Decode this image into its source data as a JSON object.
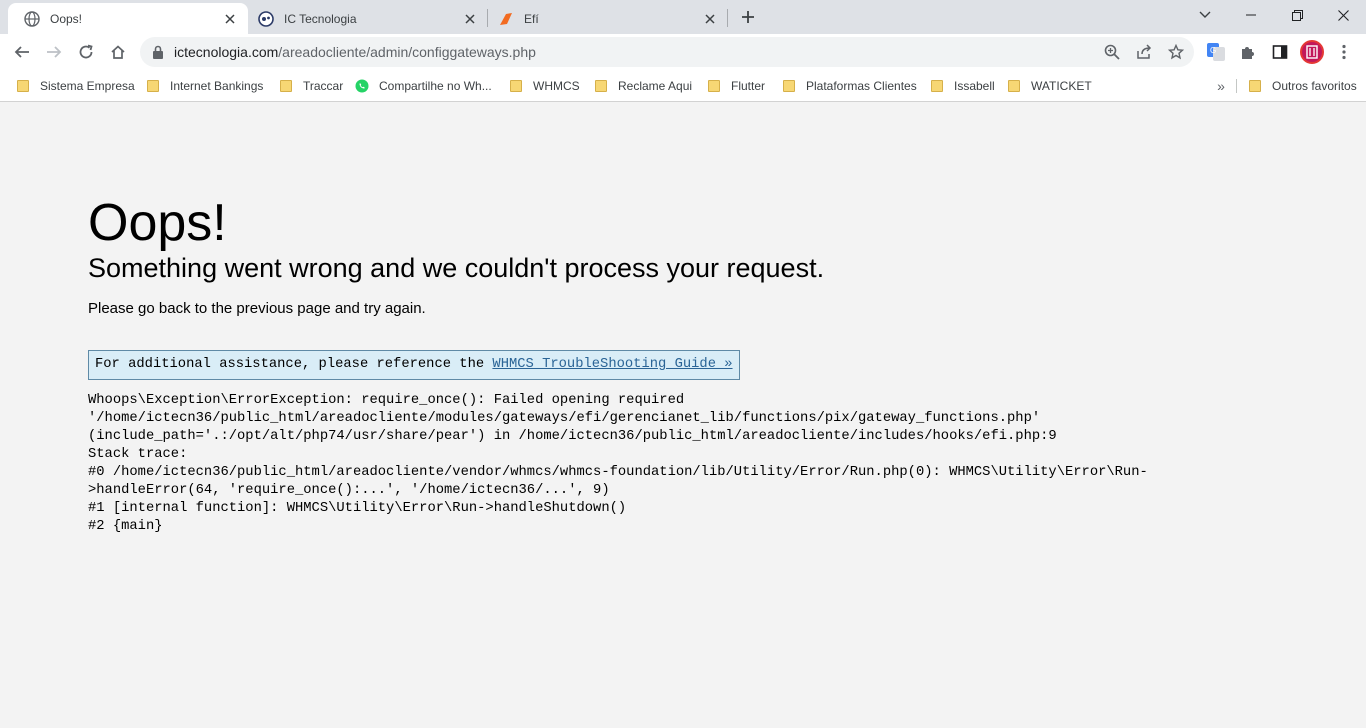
{
  "browser": {
    "tabs": [
      {
        "title": "Oops!",
        "icon": "globe-icon",
        "active": true
      },
      {
        "title": "IC Tecnologia",
        "icon": "ic-logo-icon",
        "active": false
      },
      {
        "title": "Efí",
        "icon": "efi-logo-icon",
        "active": false
      }
    ],
    "address_bar": {
      "domain": "ictecnologia.com",
      "path": "/areadocliente/admin/configgateways.php"
    },
    "bookmarks": [
      {
        "label": "Sistema Empresa",
        "icon": "folder-icon"
      },
      {
        "label": "Internet Bankings",
        "icon": "folder-icon"
      },
      {
        "label": "Traccar",
        "icon": "folder-icon"
      },
      {
        "label": "Compartilhe no Wh...",
        "icon": "whatsapp-icon"
      },
      {
        "label": "WHMCS",
        "icon": "folder-icon"
      },
      {
        "label": "Reclame Aqui",
        "icon": "folder-icon"
      },
      {
        "label": "Flutter",
        "icon": "folder-icon"
      },
      {
        "label": "Plataformas Clientes",
        "icon": "folder-icon"
      },
      {
        "label": "Issabell",
        "icon": "folder-icon"
      },
      {
        "label": "WATICKET",
        "icon": "folder-icon"
      }
    ],
    "more_bookmarks": "»",
    "other_bookmarks": "Outros favoritos",
    "colors": {
      "tabstrip": "#dee1e6",
      "toolbar": "#ffffff",
      "omnibox": "#f1f3f4",
      "folder": "#f7d774"
    }
  },
  "page": {
    "heading": "Oops!",
    "subheading": "Something went wrong and we couldn't process your request.",
    "instruction": "Please go back to the previous page and try again.",
    "assistance": {
      "text": "For additional assistance, please reference the ",
      "link": "WHMCS TroubleShooting Guide »"
    },
    "trace_lines": [
      "Whoops\\Exception\\ErrorException: require_once(): Failed opening required",
      "'/home/ictecn36/public_html/areadocliente/modules/gateways/efi/gerencianet_lib/functions/pix/gateway_functions.php'",
      "(include_path='.:/opt/alt/php74/usr/share/pear') in /home/ictecn36/public_html/areadocliente/includes/hooks/efi.php:9",
      "Stack trace:",
      "#0 /home/ictecn36/public_html/areadocliente/vendor/whmcs/whmcs-foundation/lib/Utility/Error/Run.php(0): WHMCS\\Utility\\Error\\Run-",
      ">handleError(64, 'require_once():...', '/home/ictecn36/...', 9)",
      "#1 [internal function]: WHMCS\\Utility\\Error\\Run->handleShutdown()",
      "#2 {main}"
    ],
    "colors": {
      "background": "#f3f3f3",
      "assist_bg": "#d9edf7",
      "assist_border": "#5f8aa6",
      "link": "#2a6496"
    }
  }
}
